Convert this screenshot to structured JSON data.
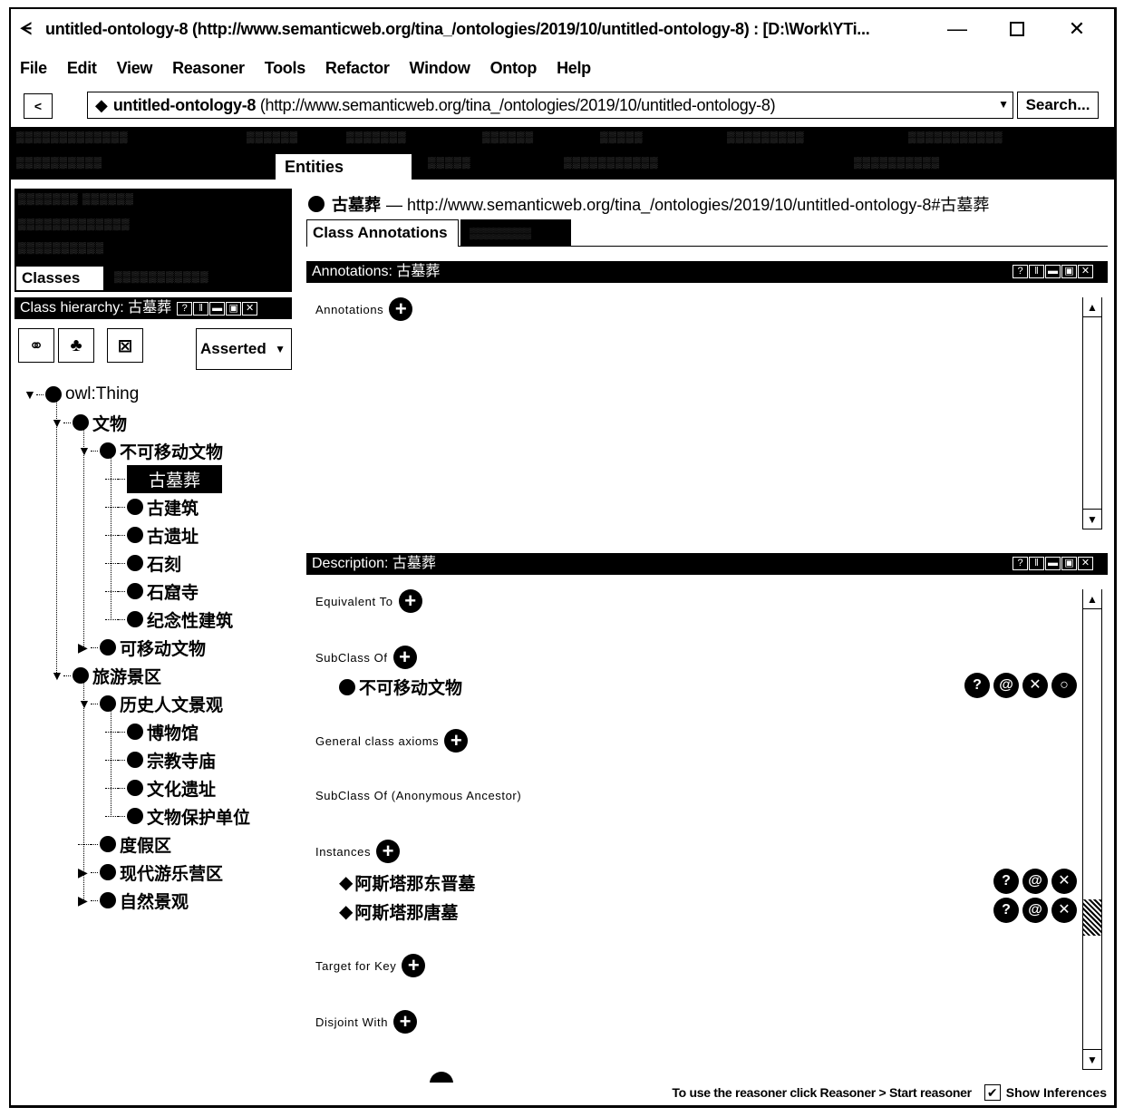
{
  "window": {
    "title": "untitled-ontology-8 (http://www.semanticweb.org/tina_/ontologies/2019/10/untitled-ontology-8)  : [D:\\Work\\YTi...",
    "controls": [
      "minimize",
      "maximize",
      "close"
    ],
    "minimize_glyph": "—",
    "close_glyph": "✕"
  },
  "menu": [
    "File",
    "Edit",
    "View",
    "Reasoner",
    "Tools",
    "Refactor",
    "Window",
    "Ontop",
    "Help"
  ],
  "navbar": {
    "back_label": "<",
    "ontology_name": "untitled-ontology-8",
    "ontology_iri": " (http://www.semanticweb.org/tina_/ontologies/2019/10/untitled-ontology-8)",
    "search_label": "Search..."
  },
  "tabs": {
    "active": "Entities"
  },
  "left": {
    "active_tab": "Classes",
    "hierarchy_header": "Class hierarchy: 古墓葬",
    "view_controls": [
      "?",
      "‖",
      "▬",
      "▣",
      "✕"
    ],
    "toolbar": {
      "add_subclass_icon": "add-subclass-icon",
      "add_sibling_icon": "add-sibling-icon",
      "delete_icon": "delete-class-icon",
      "mode": "Asserted"
    },
    "tree": [
      {
        "label": "owl:Thing",
        "depth": 0,
        "toggle": "expanded"
      },
      {
        "label": "文物",
        "depth": 1,
        "toggle": "expanded"
      },
      {
        "label": "不可移动文物",
        "depth": 2,
        "toggle": "expanded"
      },
      {
        "label": "古墓葬",
        "depth": 3,
        "toggle": "none",
        "selected": true
      },
      {
        "label": "古建筑",
        "depth": 3,
        "toggle": "none"
      },
      {
        "label": "古遗址",
        "depth": 3,
        "toggle": "none"
      },
      {
        "label": "石刻",
        "depth": 3,
        "toggle": "none"
      },
      {
        "label": "石窟寺",
        "depth": 3,
        "toggle": "none"
      },
      {
        "label": "纪念性建筑",
        "depth": 3,
        "toggle": "none"
      },
      {
        "label": "可移动文物",
        "depth": 2,
        "toggle": "collapsed"
      },
      {
        "label": "旅游景区",
        "depth": 1,
        "toggle": "expanded"
      },
      {
        "label": "历史人文景观",
        "depth": 2,
        "toggle": "expanded"
      },
      {
        "label": "博物馆",
        "depth": 3,
        "toggle": "none"
      },
      {
        "label": "宗教寺庙",
        "depth": 3,
        "toggle": "none"
      },
      {
        "label": "文化遗址",
        "depth": 3,
        "toggle": "none"
      },
      {
        "label": "文物保护单位",
        "depth": 3,
        "toggle": "none"
      },
      {
        "label": "度假区",
        "depth": 2,
        "toggle": "none"
      },
      {
        "label": "现代游乐营区",
        "depth": 2,
        "toggle": "collapsed"
      },
      {
        "label": "自然景观",
        "depth": 2,
        "toggle": "collapsed"
      }
    ]
  },
  "right": {
    "entity_name": "古墓葬",
    "entity_iri": "— http://www.semanticweb.org/tina_/ontologies/2019/10/untitled-ontology-8#古墓葬",
    "active_subtab": "Class Annotations",
    "annotations_header": "Annotations: 古墓葬",
    "annotations_label": "Annotations",
    "description_header": "Description: 古墓葬",
    "sections": {
      "equivalent_to": "Equivalent To",
      "subclass_of": "SubClass Of",
      "general_axioms": "General class axioms",
      "anon_ancestor": "SubClass Of (Anonymous Ancestor)",
      "instances": "Instances",
      "target_for_key": "Target for Key",
      "disjoint_with": "Disjoint With"
    },
    "subclass_items": [
      {
        "label": "不可移动文物",
        "actions": [
          "?",
          "@",
          "✕",
          "○"
        ]
      }
    ],
    "instance_items": [
      {
        "label": "阿斯塔那东晋墓",
        "actions": [
          "?",
          "@",
          "✕"
        ]
      },
      {
        "label": "阿斯塔那唐墓",
        "actions": [
          "?",
          "@",
          "✕"
        ]
      }
    ],
    "description_scroll_position": 0.72
  },
  "status": {
    "text": "To use the reasoner click Reasoner > Start reasoner",
    "show_inferences_label": "Show Inferences",
    "show_inferences_checked": true,
    "check_glyph": "✔"
  }
}
